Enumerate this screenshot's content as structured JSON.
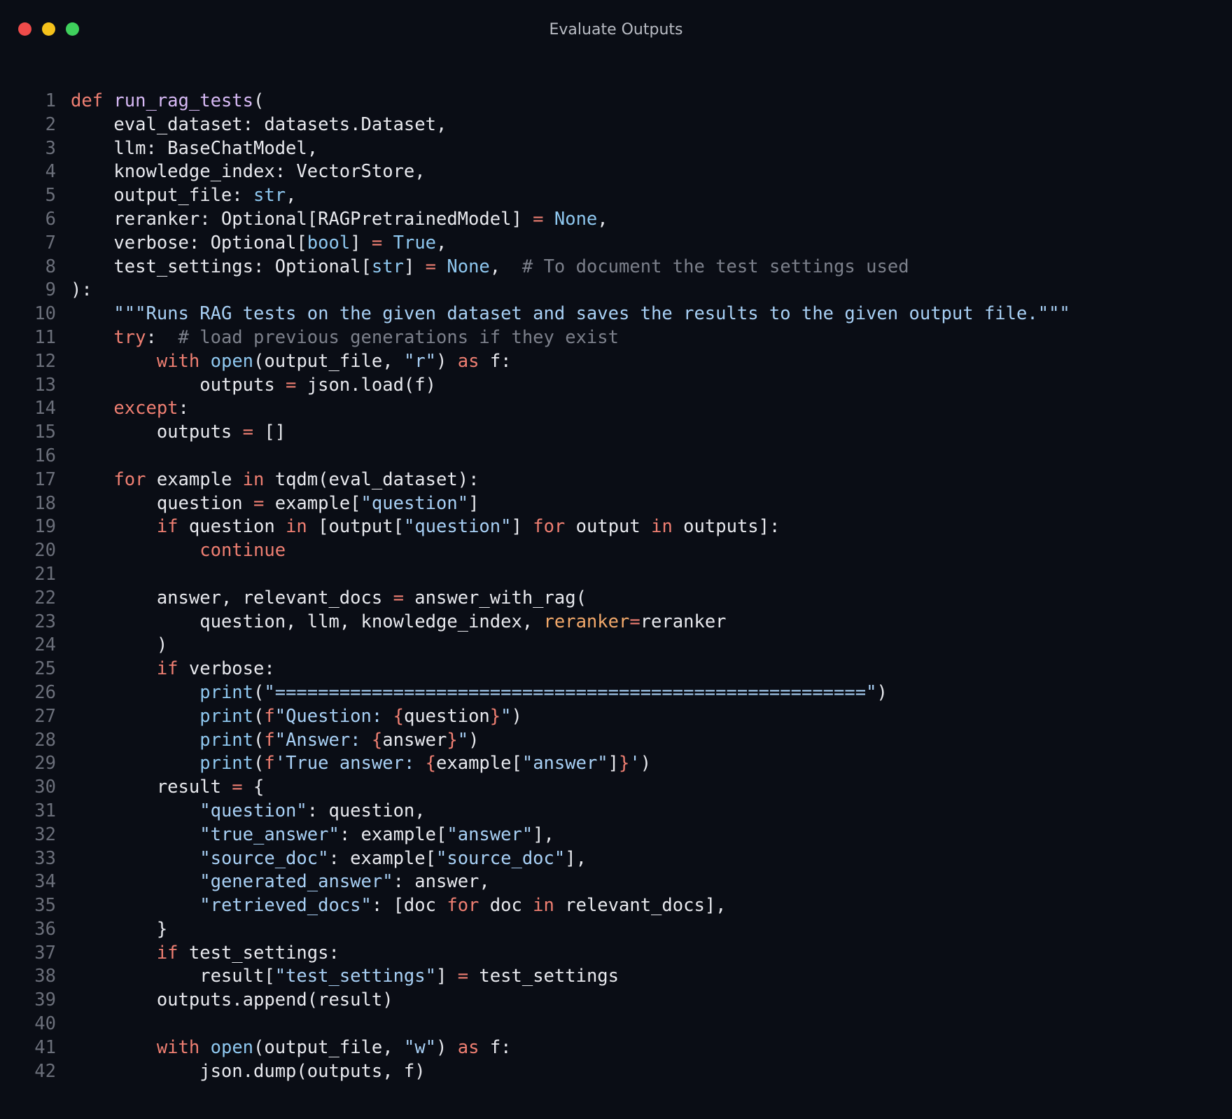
{
  "window": {
    "title": "Evaluate Outputs",
    "controls": [
      {
        "name": "close",
        "color": "#ef4b4a"
      },
      {
        "name": "minimize",
        "color": "#f5c21b"
      },
      {
        "name": "maximize",
        "color": "#3fd05c"
      }
    ]
  },
  "code": {
    "language": "python",
    "lines": [
      [
        [
          "kw",
          "def "
        ],
        [
          "fn",
          "run_rag_tests"
        ],
        [
          "pu",
          "("
        ]
      ],
      [
        [
          "pu",
          "    eval_dataset: datasets.Dataset,"
        ]
      ],
      [
        [
          "pu",
          "    llm: BaseChatModel,"
        ]
      ],
      [
        [
          "pu",
          "    knowledge_index: VectorStore,"
        ]
      ],
      [
        [
          "pu",
          "    output_file: "
        ],
        [
          "bi",
          "str"
        ],
        [
          "pu",
          ","
        ]
      ],
      [
        [
          "pu",
          "    reranker: Optional[RAGPretrainedModel] "
        ],
        [
          "kw",
          "="
        ],
        [
          "pu",
          " "
        ],
        [
          "bi",
          "None"
        ],
        [
          "pu",
          ","
        ]
      ],
      [
        [
          "pu",
          "    verbose: Optional["
        ],
        [
          "bi",
          "bool"
        ],
        [
          "pu",
          "] "
        ],
        [
          "kw",
          "="
        ],
        [
          "pu",
          " "
        ],
        [
          "bi",
          "True"
        ],
        [
          "pu",
          ","
        ]
      ],
      [
        [
          "pu",
          "    test_settings: Optional["
        ],
        [
          "bi",
          "str"
        ],
        [
          "pu",
          "] "
        ],
        [
          "kw",
          "="
        ],
        [
          "pu",
          " "
        ],
        [
          "bi",
          "None"
        ],
        [
          "pu",
          ",  "
        ],
        [
          "cm",
          "# To document the test settings used"
        ]
      ],
      [
        [
          "pu",
          "):"
        ]
      ],
      [
        [
          "pu",
          "    "
        ],
        [
          "ds",
          "\"\"\"Runs RAG tests on the given dataset and saves the results to the given output file.\"\"\""
        ]
      ],
      [
        [
          "pu",
          "    "
        ],
        [
          "kw",
          "try"
        ],
        [
          "pu",
          ":  "
        ],
        [
          "cm",
          "# load previous generations if they exist"
        ]
      ],
      [
        [
          "pu",
          "        "
        ],
        [
          "kw",
          "with"
        ],
        [
          "pu",
          " "
        ],
        [
          "bi",
          "open"
        ],
        [
          "pu",
          "(output_file, "
        ],
        [
          "str",
          "\"r\""
        ],
        [
          "pu",
          ") "
        ],
        [
          "kw",
          "as"
        ],
        [
          "pu",
          " f:"
        ]
      ],
      [
        [
          "pu",
          "            outputs "
        ],
        [
          "kw",
          "="
        ],
        [
          "pu",
          " json.load(f)"
        ]
      ],
      [
        [
          "pu",
          "    "
        ],
        [
          "kw",
          "except"
        ],
        [
          "pu",
          ":"
        ]
      ],
      [
        [
          "pu",
          "        outputs "
        ],
        [
          "kw",
          "="
        ],
        [
          "pu",
          " []"
        ]
      ],
      [],
      [
        [
          "pu",
          "    "
        ],
        [
          "kw",
          "for"
        ],
        [
          "pu",
          " example "
        ],
        [
          "kw",
          "in"
        ],
        [
          "pu",
          " tqdm(eval_dataset):"
        ]
      ],
      [
        [
          "pu",
          "        question "
        ],
        [
          "kw",
          "="
        ],
        [
          "pu",
          " example["
        ],
        [
          "str",
          "\"question\""
        ],
        [
          "pu",
          "]"
        ]
      ],
      [
        [
          "pu",
          "        "
        ],
        [
          "kw",
          "if"
        ],
        [
          "pu",
          " question "
        ],
        [
          "kw",
          "in"
        ],
        [
          "pu",
          " [output["
        ],
        [
          "str",
          "\"question\""
        ],
        [
          "pu",
          "] "
        ],
        [
          "kw",
          "for"
        ],
        [
          "pu",
          " output "
        ],
        [
          "kw",
          "in"
        ],
        [
          "pu",
          " outputs]:"
        ]
      ],
      [
        [
          "pu",
          "            "
        ],
        [
          "kw",
          "continue"
        ]
      ],
      [],
      [
        [
          "pu",
          "        answer, relevant_docs "
        ],
        [
          "kw",
          "="
        ],
        [
          "pu",
          " answer_with_rag("
        ]
      ],
      [
        [
          "pu",
          "            question, llm, knowledge_index, "
        ],
        [
          "param",
          "reranker"
        ],
        [
          "kw",
          "="
        ],
        [
          "pu",
          "reranker"
        ]
      ],
      [
        [
          "pu",
          "        )"
        ]
      ],
      [
        [
          "pu",
          "        "
        ],
        [
          "kw",
          "if"
        ],
        [
          "pu",
          " verbose:"
        ]
      ],
      [
        [
          "pu",
          "            "
        ],
        [
          "bi",
          "print"
        ],
        [
          "pu",
          "("
        ],
        [
          "str",
          "\"=======================================================\""
        ],
        [
          "pu",
          ")"
        ]
      ],
      [
        [
          "pu",
          "            "
        ],
        [
          "bi",
          "print"
        ],
        [
          "pu",
          "("
        ],
        [
          "kw",
          "f"
        ],
        [
          "str",
          "\"Question: "
        ],
        [
          "kw",
          "{"
        ],
        [
          "pu",
          "question"
        ],
        [
          "kw",
          "}"
        ],
        [
          "str",
          "\""
        ],
        [
          "pu",
          ")"
        ]
      ],
      [
        [
          "pu",
          "            "
        ],
        [
          "bi",
          "print"
        ],
        [
          "pu",
          "("
        ],
        [
          "kw",
          "f"
        ],
        [
          "str",
          "\"Answer: "
        ],
        [
          "kw",
          "{"
        ],
        [
          "pu",
          "answer"
        ],
        [
          "kw",
          "}"
        ],
        [
          "str",
          "\""
        ],
        [
          "pu",
          ")"
        ]
      ],
      [
        [
          "pu",
          "            "
        ],
        [
          "bi",
          "print"
        ],
        [
          "pu",
          "("
        ],
        [
          "kw",
          "f"
        ],
        [
          "str",
          "'True answer: "
        ],
        [
          "kw",
          "{"
        ],
        [
          "pu",
          "example["
        ],
        [
          "str",
          "\"answer\""
        ],
        [
          "pu",
          "]"
        ],
        [
          "kw",
          "}"
        ],
        [
          "str",
          "'"
        ],
        [
          "pu",
          ")"
        ]
      ],
      [
        [
          "pu",
          "        result "
        ],
        [
          "kw",
          "="
        ],
        [
          "pu",
          " {"
        ]
      ],
      [
        [
          "pu",
          "            "
        ],
        [
          "str",
          "\"question\""
        ],
        [
          "pu",
          ": question,"
        ]
      ],
      [
        [
          "pu",
          "            "
        ],
        [
          "str",
          "\"true_answer\""
        ],
        [
          "pu",
          ": example["
        ],
        [
          "str",
          "\"answer\""
        ],
        [
          "pu",
          "],"
        ]
      ],
      [
        [
          "pu",
          "            "
        ],
        [
          "str",
          "\"source_doc\""
        ],
        [
          "pu",
          ": example["
        ],
        [
          "str",
          "\"source_doc\""
        ],
        [
          "pu",
          "],"
        ]
      ],
      [
        [
          "pu",
          "            "
        ],
        [
          "str",
          "\"generated_answer\""
        ],
        [
          "pu",
          ": answer,"
        ]
      ],
      [
        [
          "pu",
          "            "
        ],
        [
          "str",
          "\"retrieved_docs\""
        ],
        [
          "pu",
          ": [doc "
        ],
        [
          "kw",
          "for"
        ],
        [
          "pu",
          " doc "
        ],
        [
          "kw",
          "in"
        ],
        [
          "pu",
          " relevant_docs],"
        ]
      ],
      [
        [
          "pu",
          "        }"
        ]
      ],
      [
        [
          "pu",
          "        "
        ],
        [
          "kw",
          "if"
        ],
        [
          "pu",
          " test_settings:"
        ]
      ],
      [
        [
          "pu",
          "            result["
        ],
        [
          "str",
          "\"test_settings\""
        ],
        [
          "pu",
          "] "
        ],
        [
          "kw",
          "="
        ],
        [
          "pu",
          " test_settings"
        ]
      ],
      [
        [
          "pu",
          "        outputs.append(result)"
        ]
      ],
      [],
      [
        [
          "pu",
          "        "
        ],
        [
          "kw",
          "with"
        ],
        [
          "pu",
          " "
        ],
        [
          "bi",
          "open"
        ],
        [
          "pu",
          "(output_file, "
        ],
        [
          "str",
          "\"w\""
        ],
        [
          "pu",
          ") "
        ],
        [
          "kw",
          "as"
        ],
        [
          "pu",
          " f:"
        ]
      ],
      [
        [
          "pu",
          "            json.dump(outputs, f)"
        ]
      ]
    ]
  }
}
